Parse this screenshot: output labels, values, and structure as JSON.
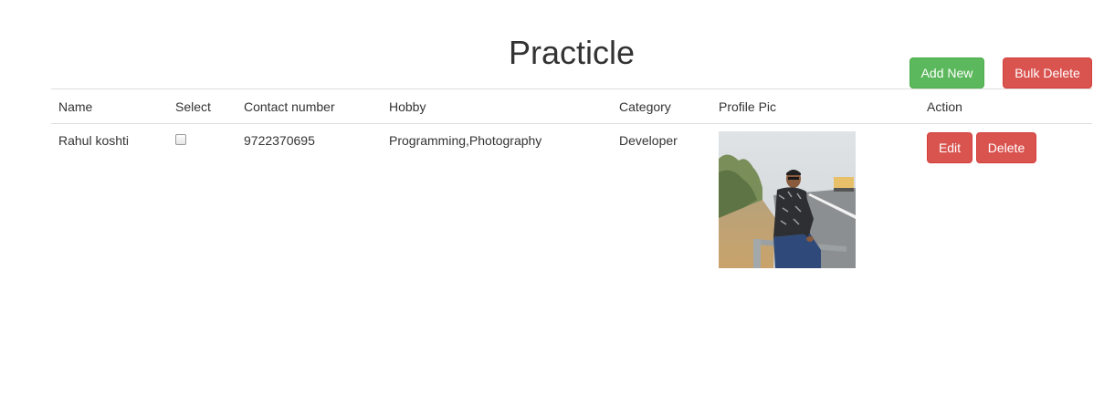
{
  "page": {
    "title": "Practicle"
  },
  "toolbar": {
    "add_new_label": "Add New",
    "bulk_delete_label": "Bulk Delete"
  },
  "table": {
    "headers": {
      "name": "Name",
      "select": "Select",
      "contact": "Contact number",
      "hobby": "Hobby",
      "category": "Category",
      "profile_pic": "Profile Pic",
      "action": "Action"
    },
    "rows": [
      {
        "name": "Rahul koshti",
        "selected": false,
        "contact": "9722370695",
        "hobby": "Programming,Photography",
        "category": "Developer",
        "edit_label": "Edit",
        "delete_label": "Delete"
      }
    ]
  },
  "colors": {
    "success": "#5cb85c",
    "danger": "#d9534f",
    "text": "#333333",
    "border": "#dddddd"
  }
}
